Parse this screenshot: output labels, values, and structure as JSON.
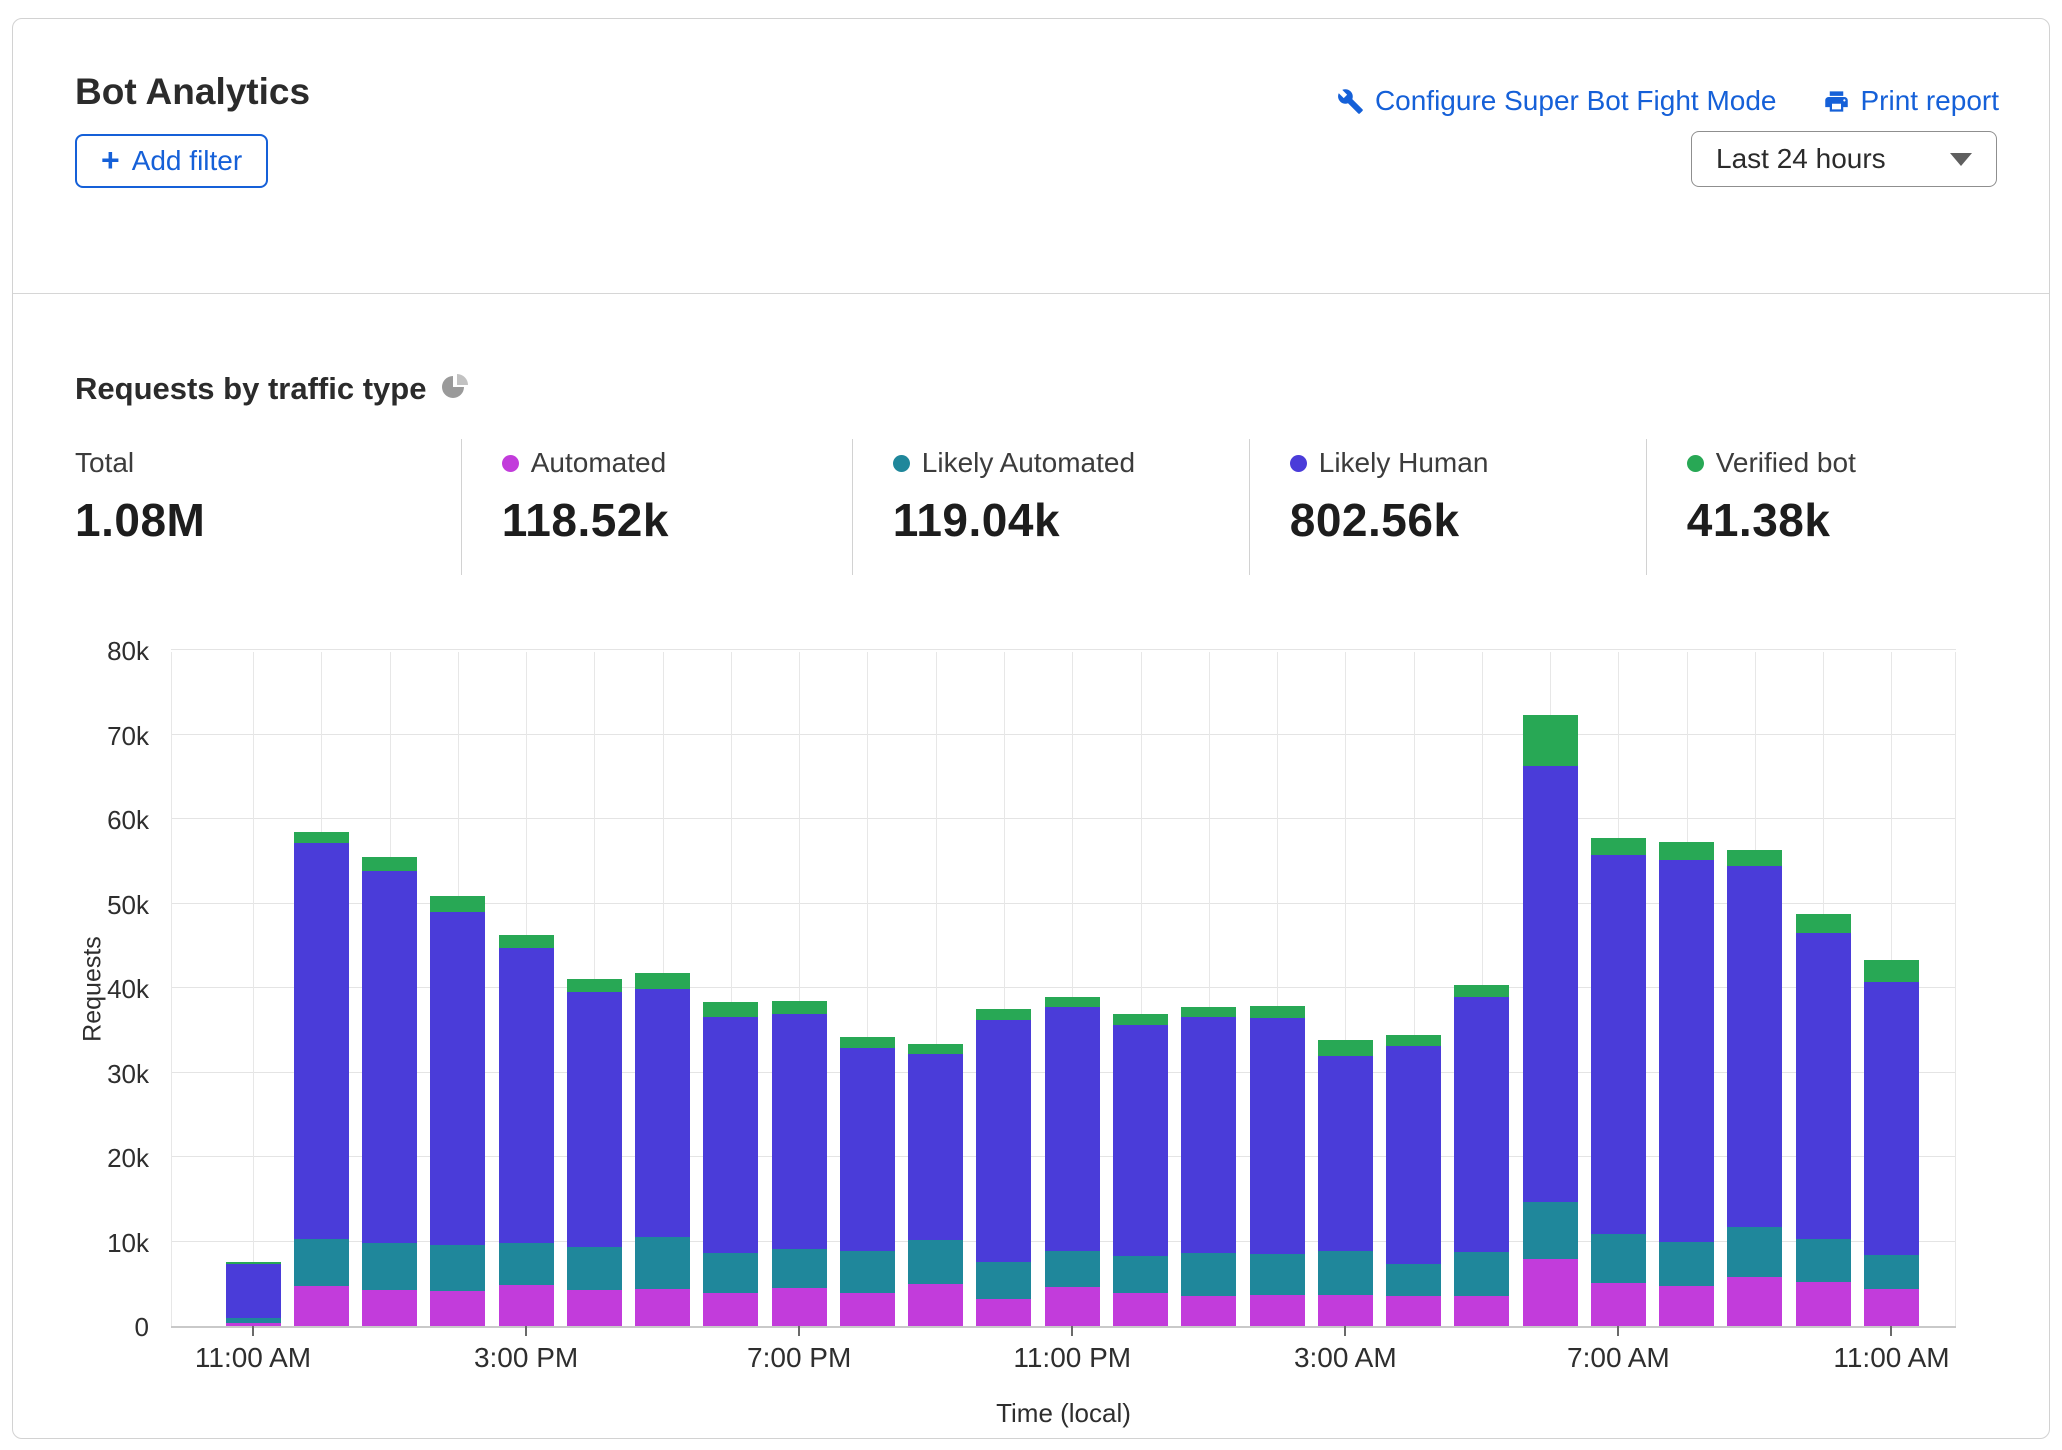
{
  "header": {
    "title": "Bot Analytics",
    "configure_link": "Configure Super Bot Fight Mode",
    "print_link": "Print report",
    "add_filter_label": "Add filter",
    "time_range_selected": "Last 24 hours"
  },
  "section": {
    "title": "Requests by traffic type"
  },
  "stats": [
    {
      "label": "Total",
      "value": "1.08M",
      "color": null
    },
    {
      "label": "Automated",
      "value": "118.52k",
      "color": "#c23cdb"
    },
    {
      "label": "Likely Automated",
      "value": "119.04k",
      "color": "#1f879b"
    },
    {
      "label": "Likely Human",
      "value": "802.56k",
      "color": "#4a3cd9"
    },
    {
      "label": "Verified bot",
      "value": "41.38k",
      "color": "#28a855"
    }
  ],
  "chart_data": {
    "type": "bar",
    "stacked": true,
    "title": "Requests by traffic type",
    "xlabel": "Time (local)",
    "ylabel": "Requests",
    "ylim": [
      0,
      80000
    ],
    "grid": true,
    "values_unit": "thousands of requests",
    "y_tick_labels": [
      "0",
      "10k",
      "20k",
      "30k",
      "40k",
      "50k",
      "60k",
      "70k",
      "80k"
    ],
    "x_tick_labels": [
      "11:00 AM",
      "3:00 PM",
      "7:00 PM",
      "11:00 PM",
      "3:00 AM",
      "7:00 AM",
      "11:00 AM"
    ],
    "x_tick_indices": [
      0,
      4,
      8,
      12,
      16,
      20,
      24
    ],
    "series": [
      {
        "name": "Automated",
        "color": "#c23cdb",
        "values": [
          0.3,
          4.7,
          4.3,
          4.1,
          4.9,
          4.3,
          4.4,
          3.9,
          4.5,
          3.9,
          5.0,
          3.2,
          4.6,
          3.9,
          3.6,
          3.7,
          3.7,
          3.6,
          3.6,
          7.9,
          5.1,
          4.7,
          5.8,
          5.2,
          4.4
        ]
      },
      {
        "name": "Likely Automated",
        "color": "#1f879b",
        "values": [
          0.7,
          5.6,
          5.5,
          5.5,
          4.9,
          5.0,
          6.1,
          4.7,
          4.6,
          5.0,
          5.2,
          4.4,
          4.3,
          4.4,
          5.0,
          4.8,
          5.2,
          3.7,
          5.2,
          6.8,
          5.8,
          5.2,
          5.9,
          5.1,
          4.0
        ]
      },
      {
        "name": "Likely Human",
        "color": "#4a3cd9",
        "values": [
          6.3,
          46.9,
          44.0,
          39.4,
          34.9,
          30.2,
          29.4,
          28.0,
          27.8,
          24.0,
          22.0,
          28.6,
          28.8,
          27.3,
          28.0,
          27.9,
          23.1,
          25.8,
          30.1,
          51.6,
          44.8,
          45.2,
          42.7,
          36.2,
          32.3
        ]
      },
      {
        "name": "Verified bot",
        "color": "#28a855",
        "values": [
          0.3,
          1.3,
          1.7,
          1.9,
          1.6,
          1.6,
          1.9,
          1.7,
          1.6,
          1.3,
          1.2,
          1.3,
          1.2,
          1.3,
          1.2,
          1.5,
          1.8,
          1.4,
          1.4,
          6.0,
          2.0,
          2.2,
          1.9,
          2.3,
          2.6
        ]
      }
    ]
  }
}
